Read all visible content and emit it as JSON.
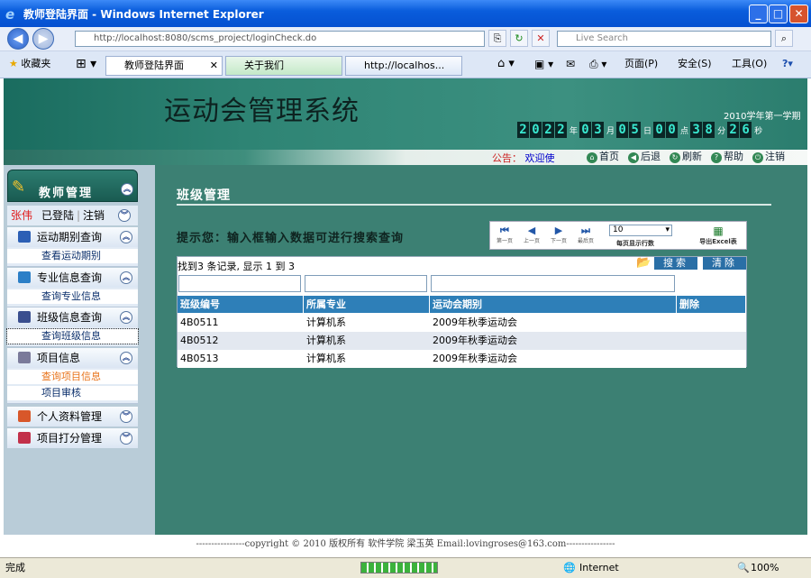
{
  "window": {
    "title": "教师登陆界面 - Windows Internet Explorer"
  },
  "browser": {
    "address": "http://localhost:8080/scms_project/loginCheck.do",
    "search_placeholder": "Live Search",
    "favorites": "收藏夹",
    "tabs": [
      "教师登陆界面",
      "关于我们",
      "http://localhos..."
    ],
    "tools": {
      "page": "页面(P)",
      "safety": "安全(S)",
      "tools": "工具(O)"
    }
  },
  "header": {
    "system_name": "运动会管理系统",
    "term": "2010学年第一学期",
    "clock": [
      {
        "digits": "2022",
        "unit": "年"
      },
      {
        "digits": "03",
        "unit": "月"
      },
      {
        "digits": "05",
        "unit": "日"
      },
      {
        "digits": "00",
        "unit": "点"
      },
      {
        "digits": "38",
        "unit": "分"
      },
      {
        "digits": "26",
        "unit": "秒"
      }
    ],
    "notice_label": "公告：",
    "notice_text": "欢迎使",
    "links": {
      "home": "首页",
      "back": "后退",
      "refresh": "刷新",
      "help": "帮助",
      "logout": "注销"
    }
  },
  "sidebar": {
    "title": "教师管理",
    "user": {
      "name": "张伟",
      "status": "已登陆",
      "logout": "注销"
    },
    "groups": [
      {
        "label": "运动期别查询",
        "items": [
          "查看运动期别"
        ]
      },
      {
        "label": "专业信息查询",
        "items": [
          "查询专业信息"
        ]
      },
      {
        "label": "班级信息查询",
        "items": [
          "查询班级信息"
        ]
      },
      {
        "label": "项目信息",
        "items": [
          "查询项目信息",
          "项目审核"
        ]
      },
      {
        "label": "个人资料管理",
        "items": []
      },
      {
        "label": "项目打分管理",
        "items": []
      }
    ]
  },
  "main": {
    "title": "班级管理",
    "hint": "提示您：输入框输入数据可进行搜索查询",
    "pager": {
      "first": "第一页",
      "prev": "上一页",
      "next": "下一页",
      "last": "最后页",
      "per_page_value": "10",
      "per_page_label": "每页显示行数",
      "export": "导出Excel表"
    },
    "found": "找到3 条记录, 显示 1 到 3",
    "search_btn": "搜索",
    "clear_btn": "清除",
    "columns": [
      "班级编号",
      "所属专业",
      "运动会期别",
      "删除"
    ],
    "rows": [
      [
        "4B0511",
        "计算机系",
        "2009年秋季运动会"
      ],
      [
        "4B0512",
        "计算机系",
        "2009年秋季运动会"
      ],
      [
        "4B0513",
        "计算机系",
        "2009年秋季运动会"
      ]
    ]
  },
  "footer": {
    "text": "----------------copyright © 2010 版权所有 软件学院 梁玉英 Email:lovingroses@163.com----------------"
  },
  "status": {
    "left": "完成",
    "zone": "Internet",
    "zoom": "100%"
  },
  "colors": {
    "header": "#2e8474",
    "main_bg": "#3c8073",
    "table_header": "#2e7fb8",
    "sidebar_bg": "#b9ccd8"
  }
}
